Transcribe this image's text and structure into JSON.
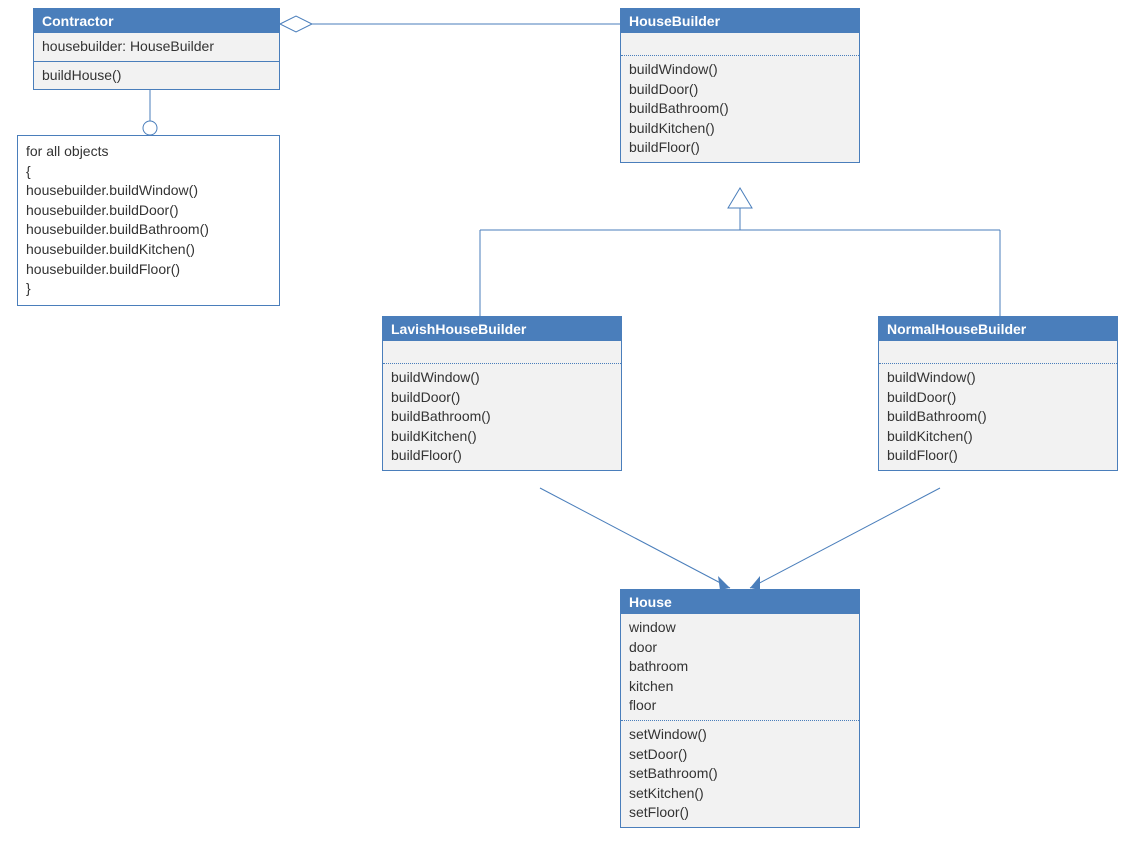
{
  "classes": {
    "contractor": {
      "title": "Contractor",
      "attributes": [
        "housebuilder: HouseBuilder"
      ],
      "methods": [
        "buildHouse()"
      ]
    },
    "houseBuilder": {
      "title": "HouseBuilder",
      "attributes": [],
      "methods": [
        "buildWindow()",
        "buildDoor()",
        "buildBathroom()",
        "buildKitchen()",
        "buildFloor()"
      ]
    },
    "lavishHouseBuilder": {
      "title": "LavishHouseBuilder",
      "attributes": [],
      "methods": [
        "buildWindow()",
        "buildDoor()",
        "buildBathroom()",
        "buildKitchen()",
        "buildFloor()"
      ]
    },
    "normalHouseBuilder": {
      "title": "NormalHouseBuilder",
      "attributes": [],
      "methods": [
        "buildWindow()",
        "buildDoor()",
        "buildBathroom()",
        "buildKitchen()",
        "buildFloor()"
      ]
    },
    "house": {
      "title": "House",
      "attributes": [
        "window",
        "door",
        "bathroom",
        "kitchen",
        "floor"
      ],
      "methods": [
        "setWindow()",
        "setDoor()",
        "setBathroom()",
        "setKitchen()",
        "setFloor()"
      ]
    }
  },
  "note": {
    "lines": [
      "for all objects",
      "{",
      " housebuilder.buildWindow()",
      " housebuilder.buildDoor()",
      " housebuilder.buildBathroom()",
      " housebuilder.buildKitchen()",
      " housebuilder.buildFloor()",
      "}"
    ]
  }
}
